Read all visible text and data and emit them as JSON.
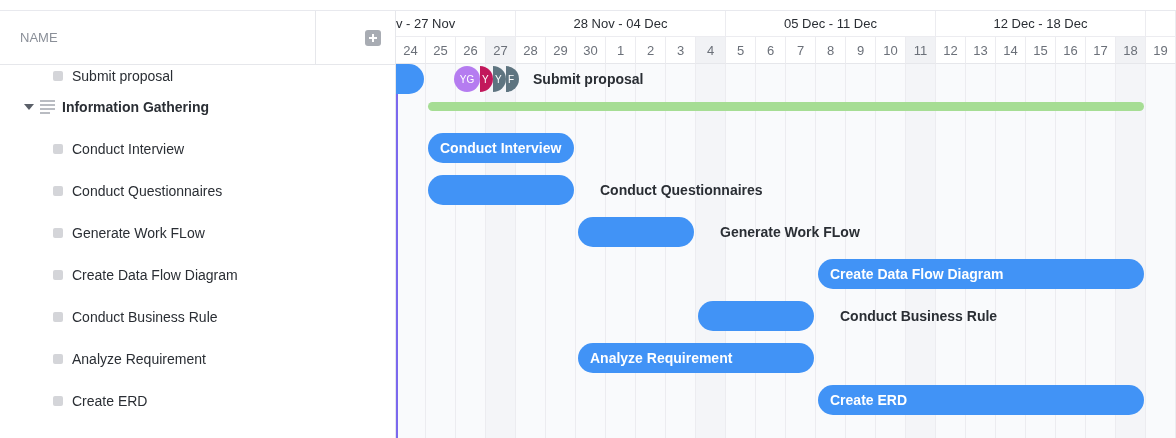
{
  "name_header": {
    "label": "NAME"
  },
  "weeks": [
    {
      "label": "v - 27 Nov",
      "days": [
        {
          "label": "24",
          "weekend": false
        },
        {
          "label": "25",
          "weekend": false
        },
        {
          "label": "26",
          "weekend": false
        },
        {
          "label": "27",
          "weekend": true
        }
      ]
    },
    {
      "label": "28 Nov - 04 Dec",
      "days": [
        {
          "label": "28",
          "weekend": false
        },
        {
          "label": "29",
          "weekend": false
        },
        {
          "label": "30",
          "weekend": false
        },
        {
          "label": "1",
          "weekend": false
        },
        {
          "label": "2",
          "weekend": false
        },
        {
          "label": "3",
          "weekend": false
        },
        {
          "label": "4",
          "weekend": true
        }
      ]
    },
    {
      "label": "05 Dec - 11 Dec",
      "days": [
        {
          "label": "5",
          "weekend": false
        },
        {
          "label": "6",
          "weekend": false
        },
        {
          "label": "7",
          "weekend": false
        },
        {
          "label": "8",
          "weekend": false
        },
        {
          "label": "9",
          "weekend": false
        },
        {
          "label": "10",
          "weekend": false
        },
        {
          "label": "11",
          "weekend": true
        }
      ]
    },
    {
      "label": "12 Dec - 18 Dec",
      "days": [
        {
          "label": "12",
          "weekend": false
        },
        {
          "label": "13",
          "weekend": false
        },
        {
          "label": "14",
          "weekend": false
        },
        {
          "label": "15",
          "weekend": false
        },
        {
          "label": "16",
          "weekend": false
        },
        {
          "label": "17",
          "weekend": false
        },
        {
          "label": "18",
          "weekend": true
        }
      ]
    },
    {
      "days": [
        {
          "label": "19",
          "weekend": false
        }
      ]
    }
  ],
  "tasks": [
    {
      "kind": "task",
      "name": "Submit proposal",
      "bar": {
        "label_inside": false,
        "label": "Submit proposal",
        "assignees": [
          {
            "initials": "YG",
            "color": "#b57cf0"
          },
          {
            "initials": "Y",
            "color": "#c2185b"
          },
          {
            "initials": "Y",
            "color": "#5e7480"
          },
          {
            "initials": "F",
            "color": "#5e7480"
          }
        ]
      }
    },
    {
      "kind": "group",
      "name": "Information Gathering",
      "expanded": true,
      "children": [
        {
          "kind": "task",
          "name": "Conduct Interview",
          "bar": {
            "label_inside": true,
            "label": "Conduct Interview"
          }
        },
        {
          "kind": "task",
          "name": "Conduct Questionnaires",
          "bar": {
            "label_inside": false,
            "label": "Conduct Questionnaires"
          }
        },
        {
          "kind": "task",
          "name": "Generate Work FLow",
          "bar": {
            "label_inside": false,
            "label": "Generate Work FLow"
          }
        },
        {
          "kind": "task",
          "name": "Create Data Flow Diagram",
          "bar": {
            "label_inside": true,
            "label": "Create Data Flow Diagram"
          }
        },
        {
          "kind": "task",
          "name": "Conduct Business Rule",
          "bar": {
            "label_inside": false,
            "label": "Conduct Business Rule"
          }
        },
        {
          "kind": "task",
          "name": "Analyze Requirement",
          "bar": {
            "label_inside": true,
            "label": "Analyze Requirement"
          }
        },
        {
          "kind": "task",
          "name": "Create ERD",
          "bar": {
            "label_inside": true,
            "label": "Create ERD"
          }
        }
      ]
    }
  ]
}
